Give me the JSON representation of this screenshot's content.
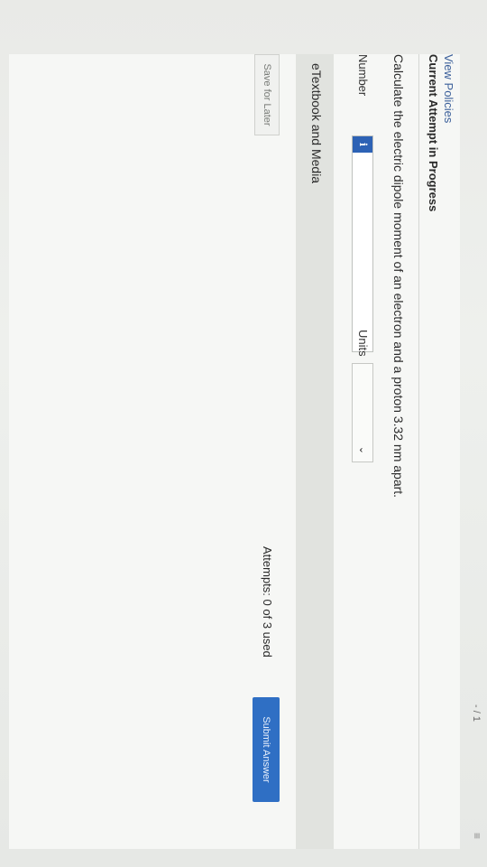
{
  "header": {
    "view_policies": "View Policies",
    "attempt_status": "Current Attempt in Progress",
    "corner_mark": "- / 1"
  },
  "question": {
    "text": "Calculate the electric dipole moment of an electron and a proton 3.32 nm apart."
  },
  "answer": {
    "number_label": "Number",
    "number_value": "",
    "info_icon": "i",
    "units_label": "Units",
    "units_value": "",
    "units_icon": "chevron-down-icon"
  },
  "resources": {
    "etextbook_label": "eTextbook and Media"
  },
  "footer": {
    "save_label": "Save for Later",
    "attempts_text": "Attempts: 0 of 3 used",
    "submit_label": "Submit Answer"
  },
  "colors": {
    "link": "#3b5f9a",
    "submit": "#2f6fc4",
    "info_badge": "#2d62b5"
  }
}
